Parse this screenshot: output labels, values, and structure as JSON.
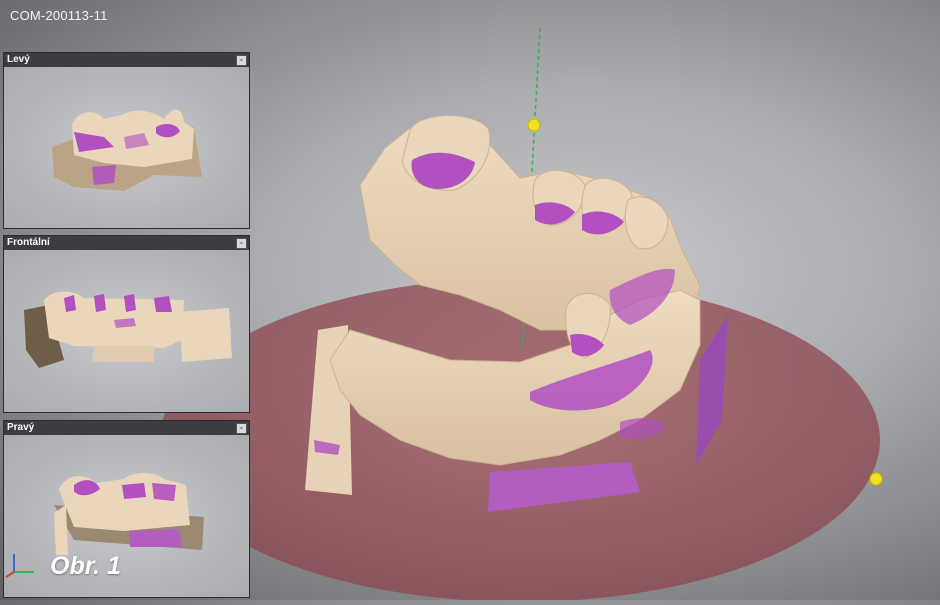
{
  "window": {
    "title": "COM-200113-11"
  },
  "panels": [
    {
      "label": "Levý",
      "button": "-"
    },
    {
      "label": "Frontální",
      "button": "-"
    },
    {
      "label": "Pravý",
      "button": "-"
    }
  ],
  "caption": "Obr. 1",
  "colors": {
    "model": "#e3cdb0",
    "highlight": "#b24fc1",
    "plane": "#9c4d55",
    "handle": "#f2e21a",
    "axis": "#37b24d"
  },
  "icons": {
    "axis_gizmo": "axis-triad-icon",
    "panel_button": "minimize-icon",
    "handle": "yellow-sphere-handle"
  }
}
